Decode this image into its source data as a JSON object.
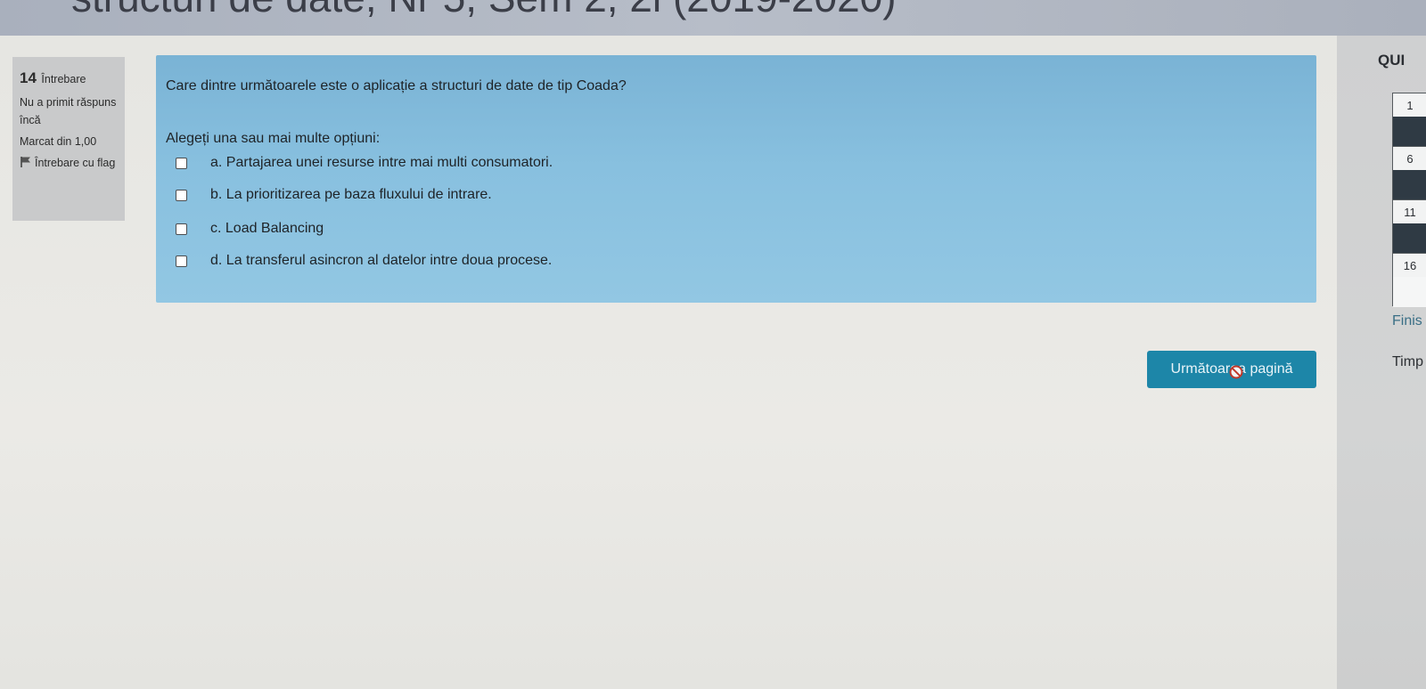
{
  "banner": {
    "partial_text": "structuri de date, Nr 5, Sem 2, 2i (2019-2020)"
  },
  "question_info": {
    "number": "14",
    "number_word": "Întrebare",
    "status": "Nu a primit răspuns încă",
    "mark": "Marcat din 1,00",
    "flag_label": "Întrebare cu flag"
  },
  "question": {
    "text": "Care dintre următoarele este o aplicație a structuri de date de tip Coada?",
    "prompt": "Alegeți una sau mai multe opțiuni:",
    "answers": [
      {
        "label": "a. Partajarea unei resurse intre mai multi consumatori.",
        "checked": false
      },
      {
        "label": "b. La prioritizarea pe baza fluxului de intrare.",
        "checked": false
      },
      {
        "label": "c. Load Balancing",
        "checked": false
      },
      {
        "label": "d. La transferul asincron al datelor intre doua procese.",
        "checked": false
      }
    ]
  },
  "next_button": {
    "label": "Următoarea pagină"
  },
  "quiz_nav": {
    "title": "QUI",
    "cells": [
      {
        "number": "1",
        "answered": true
      },
      {
        "number": "6",
        "answered": true
      },
      {
        "number": "11",
        "answered": true
      },
      {
        "number": "16",
        "answered": false
      }
    ],
    "finish_label": "Finis",
    "timer_label": "Timp"
  },
  "colors": {
    "question_panel": "#88c0df",
    "info_box": "#c9cacb",
    "next_button": "#1d86a8",
    "nav_answered": "#2f3a44"
  }
}
